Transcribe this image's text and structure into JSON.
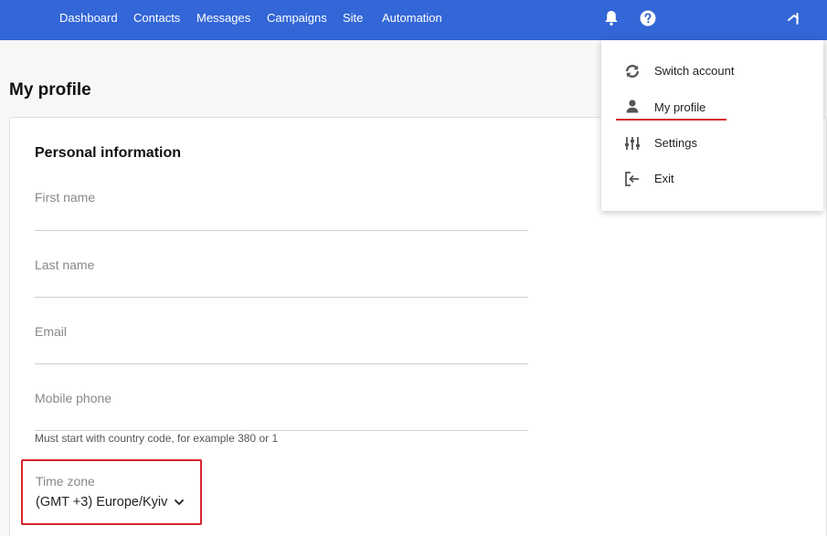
{
  "nav": {
    "items": [
      {
        "label": "Dashboard"
      },
      {
        "label": "Contacts"
      },
      {
        "label": "Messages"
      },
      {
        "label": "Campaigns"
      },
      {
        "label": "Site"
      },
      {
        "label": "Automation"
      }
    ],
    "icons": [
      "bell-icon",
      "help-icon",
      "avatar-icon"
    ],
    "color": "#3366d6"
  },
  "page": {
    "title": "My profile"
  },
  "personal": {
    "title": "Personal information",
    "first_name": {
      "label": "First name",
      "value": ""
    },
    "last_name": {
      "label": "Last name",
      "value": ""
    },
    "email": {
      "label": "Email",
      "value": ""
    },
    "mobile": {
      "label": "Mobile phone",
      "value": "",
      "hint": "Must start with country code, for example 380 or 1"
    },
    "timezone": {
      "label": "Time zone",
      "value": "(GMT +3) Europe/Kyiv"
    }
  },
  "menu": {
    "items": [
      {
        "label": "Switch account",
        "icon": "switch-account-icon"
      },
      {
        "label": "My profile",
        "icon": "user-icon"
      },
      {
        "label": "Settings",
        "icon": "settings-sliders-icon"
      },
      {
        "label": "Exit",
        "icon": "exit-icon"
      }
    ]
  },
  "colors": {
    "highlight": "#d9232d"
  }
}
